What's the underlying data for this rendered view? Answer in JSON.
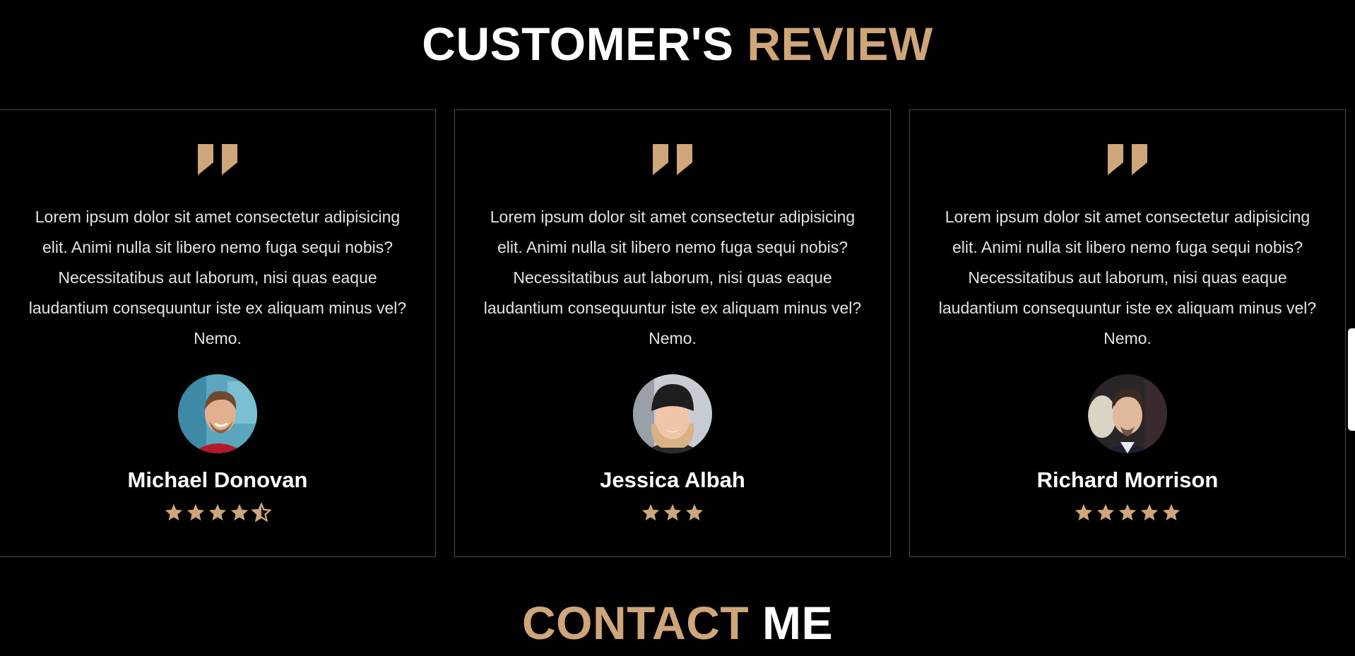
{
  "section_heading": {
    "part1": "CUSTOMER'S",
    "part2": "REVIEW"
  },
  "contact_heading": {
    "part1": "CONTACT",
    "part2": "ME"
  },
  "colors": {
    "background": "#000000",
    "accent": "#cfa57a",
    "text": "#ffffff",
    "body_text": "#e3e3e3",
    "card_border": "#4a4a4a"
  },
  "reviews": [
    {
      "quote_icon": "quote-icon",
      "text": "Lorem ipsum dolor sit amet consectetur adipisicing elit. Animi nulla sit libero nemo fuga sequi nobis? Necessitatibus aut laborum, nisi quas eaque laudantium consequuntur iste ex aliquam minus vel? Nemo.",
      "name": "Michael Donovan",
      "rating": 4.5,
      "avatar_icon": "avatar-photo"
    },
    {
      "quote_icon": "quote-icon",
      "text": "Lorem ipsum dolor sit amet consectetur adipisicing elit. Animi nulla sit libero nemo fuga sequi nobis? Necessitatibus aut laborum, nisi quas eaque laudantium consequuntur iste ex aliquam minus vel? Nemo.",
      "name": "Jessica Albah",
      "rating": 3,
      "avatar_icon": "avatar-photo"
    },
    {
      "quote_icon": "quote-icon",
      "text": "Lorem ipsum dolor sit amet consectetur adipisicing elit. Animi nulla sit libero nemo fuga sequi nobis? Necessitatibus aut laborum, nisi quas eaque laudantium consequuntur iste ex aliquam minus vel? Nemo.",
      "name": "Richard Morrison",
      "rating": 5,
      "avatar_icon": "avatar-photo"
    }
  ]
}
